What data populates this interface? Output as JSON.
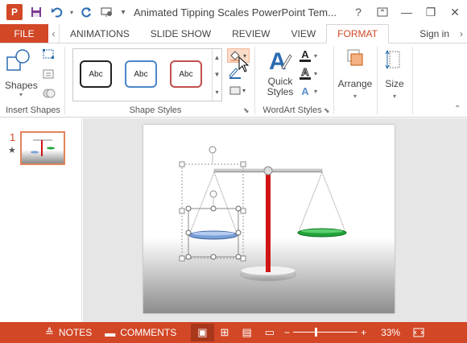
{
  "app": {
    "title": "Animated Tipping Scales PowerPoint Tem...",
    "logo_letter": "P"
  },
  "window": {
    "help": "?",
    "minimize": "—",
    "restore": "❐",
    "close": "✕"
  },
  "tabs": {
    "file": "FILE",
    "items": [
      "ANIMATIONS",
      "SLIDE SHOW",
      "REVIEW",
      "VIEW",
      "FORMAT"
    ],
    "active": "FORMAT",
    "signin": "Sign in"
  },
  "ribbon": {
    "insert_shapes": {
      "label": "Insert Shapes",
      "shapes_label": "Shapes"
    },
    "shape_styles": {
      "label": "Shape Styles",
      "swatches": [
        "Abc",
        "Abc",
        "Abc"
      ]
    },
    "wordart": {
      "label": "WordArt Styles",
      "quick_styles_line1": "Quick",
      "quick_styles_line2": "Styles",
      "A": "A"
    },
    "arrange": {
      "label": "Arrange"
    },
    "size": {
      "label": "Size"
    }
  },
  "thumbnails": [
    {
      "number": "1",
      "star": "★"
    }
  ],
  "status": {
    "notes": "NOTES",
    "comments": "COMMENTS",
    "zoom": "33%",
    "zoom_minus": "−",
    "zoom_plus": "+"
  },
  "colors": {
    "accent": "#d24726",
    "swatch_black": "#222222",
    "swatch_blue": "#4a86c8",
    "swatch_red": "#c0504d",
    "pan_blue": "#7aa0d8",
    "pan_green": "#22a33a",
    "pole_red": "#d01515"
  }
}
